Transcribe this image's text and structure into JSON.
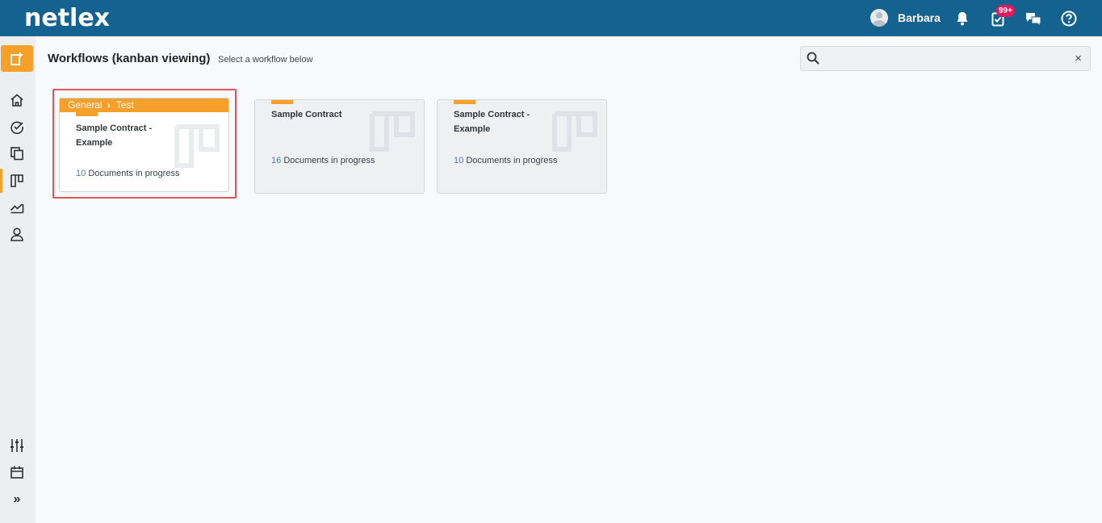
{
  "header": {
    "logo": "netlex",
    "user_name": "Barbara",
    "tasks_badge": "99+"
  },
  "page": {
    "title": "Workflows (kanban viewing)",
    "subtitle": "Select a workflow below"
  },
  "search": {
    "value": "",
    "clear": "×"
  },
  "breadcrumb": {
    "parent": "General",
    "separator": "›",
    "current": "Test"
  },
  "workflows": [
    {
      "title": "Sample Contract - Example",
      "count": "10",
      "docs_label": "Documents in progress"
    },
    {
      "title": "Sample Contract",
      "count": "16",
      "docs_label": "Documents in progress"
    },
    {
      "title": "Sample Contract - Example",
      "count": "10",
      "docs_label": "Documents in progress"
    }
  ],
  "sidebar": {
    "collapse": "»"
  },
  "colors": {
    "topbar": "#14628f",
    "accent": "#f5a02b",
    "badge": "#e4185a",
    "link": "#3d7fc1",
    "highlight": "#e0555a"
  }
}
